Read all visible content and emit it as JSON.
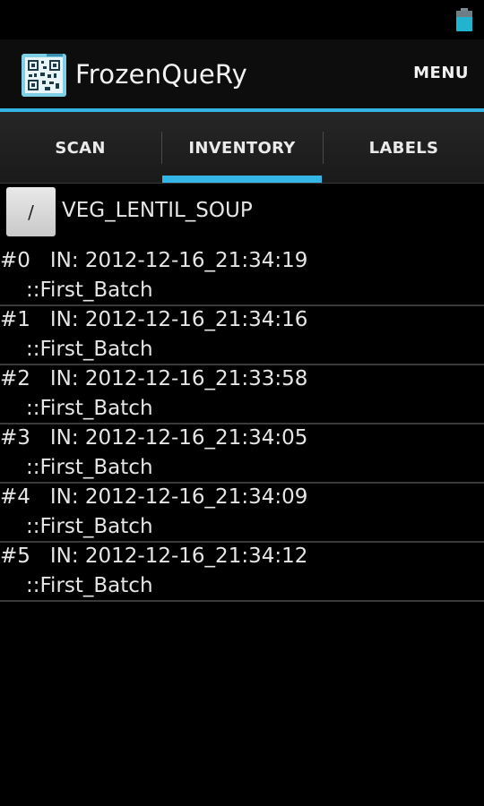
{
  "status_bar": {
    "battery_icon": "battery-icon"
  },
  "action_bar": {
    "app_icon": "qr-code-app-icon",
    "title": "FrozenQueRy",
    "menu_label": "MENU"
  },
  "tabs": [
    {
      "label": "SCAN",
      "selected": false
    },
    {
      "label": "INVENTORY",
      "selected": true
    },
    {
      "label": "LABELS",
      "selected": false
    }
  ],
  "inventory": {
    "path_button_label": "/",
    "item_name": "VEG_LENTIL_SOUP",
    "entries": [
      {
        "index": "#0",
        "in_label": "IN: 2012-12-16_21:34:19",
        "batch": "::First_Batch"
      },
      {
        "index": "#1",
        "in_label": "IN: 2012-12-16_21:34:16",
        "batch": "::First_Batch"
      },
      {
        "index": "#2",
        "in_label": "IN: 2012-12-16_21:33:58",
        "batch": "::First_Batch"
      },
      {
        "index": "#3",
        "in_label": "IN: 2012-12-16_21:34:05",
        "batch": "::First_Batch"
      },
      {
        "index": "#4",
        "in_label": "IN: 2012-12-16_21:34:09",
        "batch": "::First_Batch"
      },
      {
        "index": "#5",
        "in_label": "IN: 2012-12-16_21:34:12",
        "batch": "::First_Batch"
      }
    ]
  },
  "colors": {
    "accent": "#33b5e5",
    "background": "#000000"
  }
}
